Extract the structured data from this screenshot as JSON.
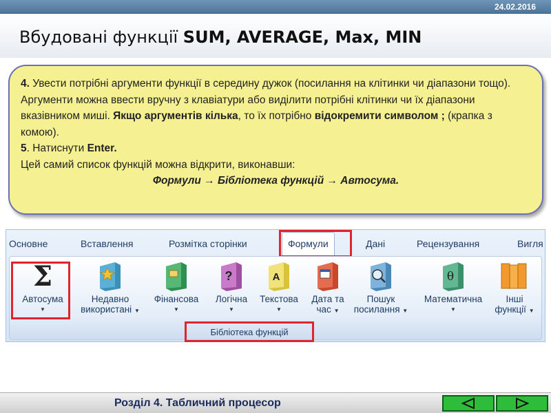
{
  "header": {
    "date": "24.02.2016",
    "title_prefix": "Вбудовані функції ",
    "title_bold": "SUM, AVERAGE, Max, MIN"
  },
  "callout": {
    "step4_num": "4.",
    "step4_text_a": " Увести потрібні аргументи функції в середину дужок (посилання на клітинки чи діапазони тощо). Аргументи можна ввести вручну з клавіатури або виділити потрібні клітинки чи їх діапазони вказівником миші. ",
    "step4_bold_a": "Якщо аргументів кілька",
    "step4_text_b": ", то їх потрібно ",
    "step4_bold_b": "відокремити символом ;",
    "step4_text_c": " (крапка з комою).",
    "step5_num": "5",
    "step5_text": ". Натиснути ",
    "step5_bold": "Enter.",
    "line_open": "Цей самий список функцій можна відкрити, виконавши:",
    "path": "Формули → Бібліотека функцій → Автосума."
  },
  "ribbon": {
    "tabs": [
      {
        "label": "Основне"
      },
      {
        "label": "Вставлення"
      },
      {
        "label": "Розмітка сторінки"
      },
      {
        "label": "Формули"
      },
      {
        "label": "Дані"
      },
      {
        "label": "Рецензування"
      },
      {
        "label": "Вигля"
      }
    ],
    "buttons": [
      {
        "line1": "Автосума",
        "line2": "",
        "icon": "sigma-icon"
      },
      {
        "line1": "Недавно",
        "line2": "використані",
        "icon": "star-book-icon"
      },
      {
        "line1": "Фінансова",
        "line2": "",
        "icon": "finance-book-icon"
      },
      {
        "line1": "Логічна",
        "line2": "",
        "icon": "question-book-icon"
      },
      {
        "line1": "Текстова",
        "line2": "",
        "icon": "text-book-icon"
      },
      {
        "line1": "Дата та",
        "line2": "час",
        "icon": "calendar-book-icon"
      },
      {
        "line1": "Пошук",
        "line2": "посилання",
        "icon": "magnifier-book-icon"
      },
      {
        "line1": "Математична",
        "line2": "",
        "icon": "theta-book-icon"
      },
      {
        "line1": "Інші",
        "line2": "функції",
        "icon": "books-icon"
      }
    ],
    "group_label": "Бібліотека функцій"
  },
  "footer": {
    "section": "Розділ 4. Табличний процесор"
  },
  "colors": {
    "highlight": "#e0242f",
    "callout_bg": "#f5f192",
    "nav_green": "#2ebd3a"
  }
}
